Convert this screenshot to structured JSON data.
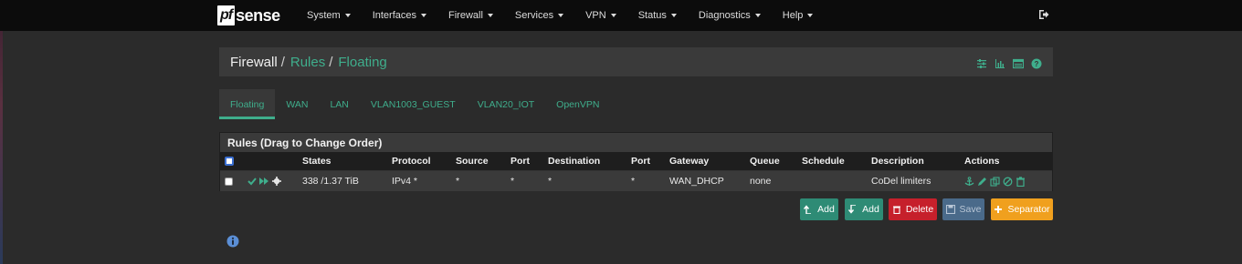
{
  "navbar": {
    "brand_pf": "pf",
    "brand_sense": "sense",
    "menu": [
      {
        "label": "System"
      },
      {
        "label": "Interfaces"
      },
      {
        "label": "Firewall"
      },
      {
        "label": "Services"
      },
      {
        "label": "VPN"
      },
      {
        "label": "Status"
      },
      {
        "label": "Diagnostics"
      },
      {
        "label": "Help"
      }
    ]
  },
  "breadcrumb": {
    "root": "Firewall",
    "sep": "/",
    "level1": "Rules",
    "level2": "Floating"
  },
  "tabs": [
    {
      "label": "Floating",
      "active": true
    },
    {
      "label": "WAN"
    },
    {
      "label": "LAN"
    },
    {
      "label": "VLAN1003_GUEST"
    },
    {
      "label": "VLAN20_IOT"
    },
    {
      "label": "OpenVPN"
    }
  ],
  "rules_panel": {
    "title": "Rules (Drag to Change Order)",
    "columns": {
      "states": "States",
      "protocol": "Protocol",
      "source": "Source",
      "port": "Port",
      "destination": "Destination",
      "port2": "Port",
      "gateway": "Gateway",
      "queue": "Queue",
      "schedule": "Schedule",
      "description": "Description",
      "actions": "Actions"
    },
    "rows": [
      {
        "states": "338 /1.37 TiB",
        "protocol": "IPv4 *",
        "source": "*",
        "port": "*",
        "destination": "*",
        "port2": "*",
        "gateway": "WAN_DHCP",
        "queue": "none",
        "schedule": "",
        "description": "CoDel limiters"
      }
    ]
  },
  "buttons": {
    "add_top": "Add",
    "add_bottom": "Add",
    "delete": "Delete",
    "save": "Save",
    "separator": "Separator"
  },
  "colors": {
    "accent": "#3fae8c",
    "add": "#2e8b75",
    "delete": "#c6202b",
    "save": "#4a6a8a",
    "separator": "#f0a01e"
  }
}
